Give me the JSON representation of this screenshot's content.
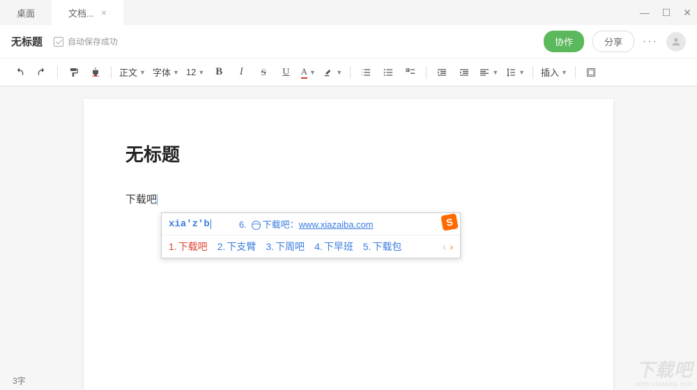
{
  "tabs": {
    "desktop": "桌面",
    "doc": "文档..."
  },
  "title_row": {
    "title": "无标题",
    "autosave": "自动保存成功",
    "collab": "协作",
    "share": "分享",
    "more": "···"
  },
  "toolbar": {
    "body_text": "正文",
    "font": "字体",
    "size": "12",
    "bold": "B",
    "italic": "I",
    "strike": "S",
    "underline": "U",
    "insert": "插入"
  },
  "page": {
    "heading": "无标题",
    "text": "下载吧"
  },
  "ime": {
    "input": "xia'z'b",
    "web_num": "6.",
    "web_label": "下载吧：",
    "web_url": "www.xiazaiba.com",
    "logo": "S",
    "candidates": [
      {
        "n": "1.",
        "t": "下载吧"
      },
      {
        "n": "2.",
        "t": "下支臂"
      },
      {
        "n": "3.",
        "t": "下周吧"
      },
      {
        "n": "4.",
        "t": "下早班"
      },
      {
        "n": "5.",
        "t": "下载包"
      }
    ]
  },
  "status": {
    "chars": "3字"
  },
  "watermark": {
    "big": "下载吧",
    "small": "www.xiazaiba.com"
  }
}
